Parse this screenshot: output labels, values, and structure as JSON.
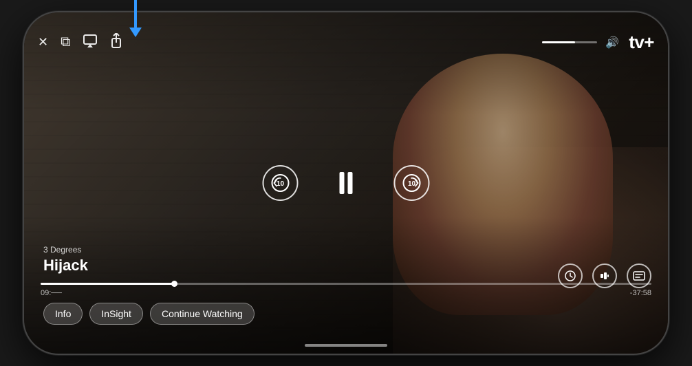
{
  "app": {
    "title": "Apple TV+",
    "logo_text": "tv+",
    "apple_symbol": ""
  },
  "show": {
    "season": "3 Degrees",
    "title": "Hijack"
  },
  "player": {
    "time_current": "09:──",
    "time_remaining": "-37:58",
    "progress_percent": 22
  },
  "controls": {
    "close_label": "✕",
    "picture_in_picture_label": "⧉",
    "airplay_label": "▱",
    "share_label": "↑",
    "rewind_seconds": "10",
    "forward_seconds": "10",
    "pause_label": "⏸",
    "volume_label": "🔊"
  },
  "bottom_buttons": {
    "info_label": "Info",
    "insight_label": "InSight",
    "continue_label": "Continue Watching"
  },
  "annotation": {
    "arrow_color": "#3399ff"
  }
}
